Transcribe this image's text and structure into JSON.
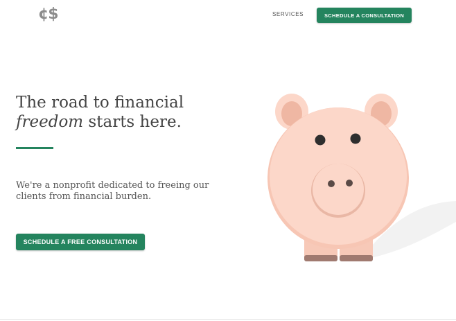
{
  "header": {
    "logo_text": "¢$",
    "nav": [
      {
        "label": "SERVICES"
      }
    ],
    "cta_label": "SCHEDULE A CONSULTATION"
  },
  "hero": {
    "title_line1": "The road to financial",
    "title_emphasis": "freedom",
    "title_rest": " starts here.",
    "body": "We're a nonprofit dedicated to freeing our clients from financial burden.",
    "cta_label": "SCHEDULE A FREE CONSULTATION"
  },
  "colors": {
    "accent": "#24845e",
    "pig_body": "#fcd7c9",
    "pig_ear_inner": "#efb7a3",
    "pig_feet": "#a07a70",
    "logo": "#8c8c8c"
  },
  "illustration": {
    "icon": "piggy-bank-illustration"
  }
}
